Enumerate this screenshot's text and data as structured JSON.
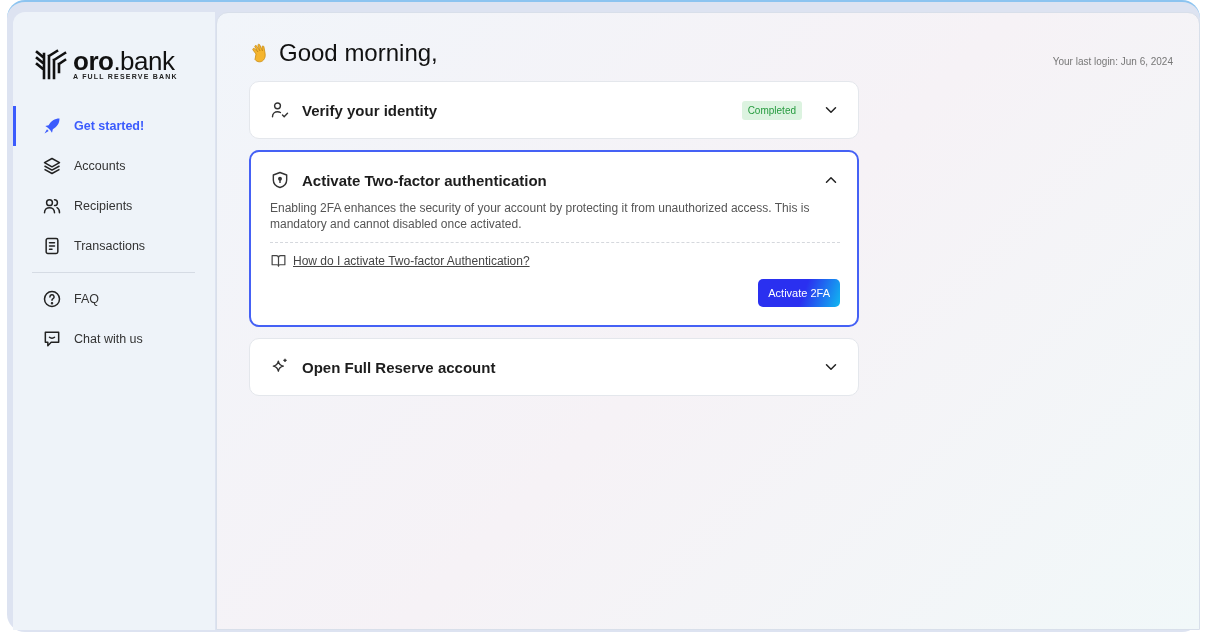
{
  "brand": {
    "name": "**oro**.bank",
    "tagline": "A FULL RESERVE BANK"
  },
  "sidebar": {
    "items": [
      {
        "label": "Get started!",
        "selected": true
      },
      {
        "label": "Accounts",
        "selected": false
      },
      {
        "label": "Recipients",
        "selected": false
      },
      {
        "label": "Transactions",
        "selected": false
      }
    ],
    "support_items": [
      {
        "label": "FAQ",
        "selected": false
      },
      {
        "label": "Chat with us",
        "selected": false
      }
    ]
  },
  "greeting": "Good morning,",
  "last_login": "Your last login: Jun 6, 2024",
  "steps": [
    {
      "title": "Verify your identity",
      "badge": "Completed",
      "expanded": false
    },
    {
      "title": "Activate Two-factor authentication",
      "expanded": true,
      "description": "Enabling 2FA enhances the security of your account by protecting it from unauthorized access. This is mandatory and cannot disabled once activated.",
      "link": "How do I activate Two-factor Authentication?",
      "button": "Activate 2FA"
    },
    {
      "title": "Open Full Reserve account",
      "expanded": false
    }
  ]
}
